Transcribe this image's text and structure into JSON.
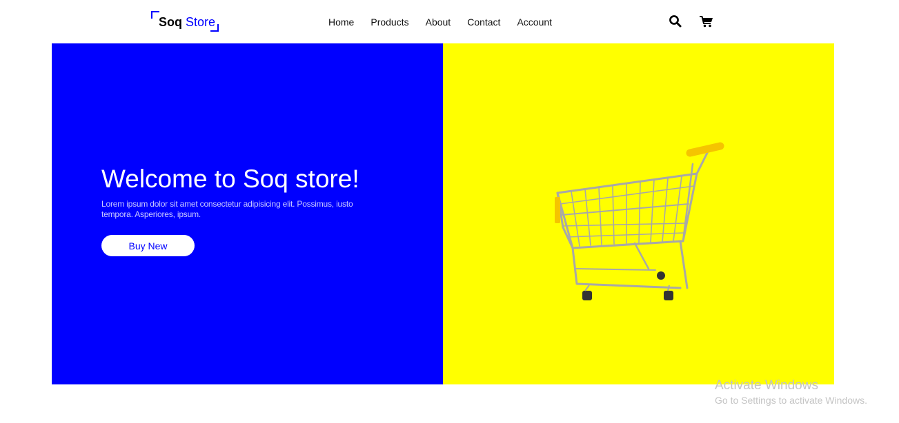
{
  "header": {
    "logo": {
      "bold": "Soq",
      "light": "Store"
    },
    "nav": [
      {
        "label": "Home"
      },
      {
        "label": "Products"
      },
      {
        "label": "About"
      },
      {
        "label": "Contact"
      },
      {
        "label": "Account"
      }
    ],
    "icons": {
      "search": "search-icon",
      "cart": "cart-icon"
    }
  },
  "hero": {
    "title": "Welcome to Soq store!",
    "text": "Lorem ipsum dolor sit amet consectetur adipisicing elit. Possimus, iusto tempora. Asperiores, ipsum.",
    "button": "Buy New",
    "image": "shopping-cart-image"
  },
  "watermark": {
    "title": "Activate Windows",
    "subtitle": "Go to Settings to activate Windows."
  },
  "colors": {
    "accent": "#0000ff",
    "hero_left_bg": "#0000ff",
    "hero_right_bg": "#ffff00",
    "cart_handle": "#f5c400"
  }
}
